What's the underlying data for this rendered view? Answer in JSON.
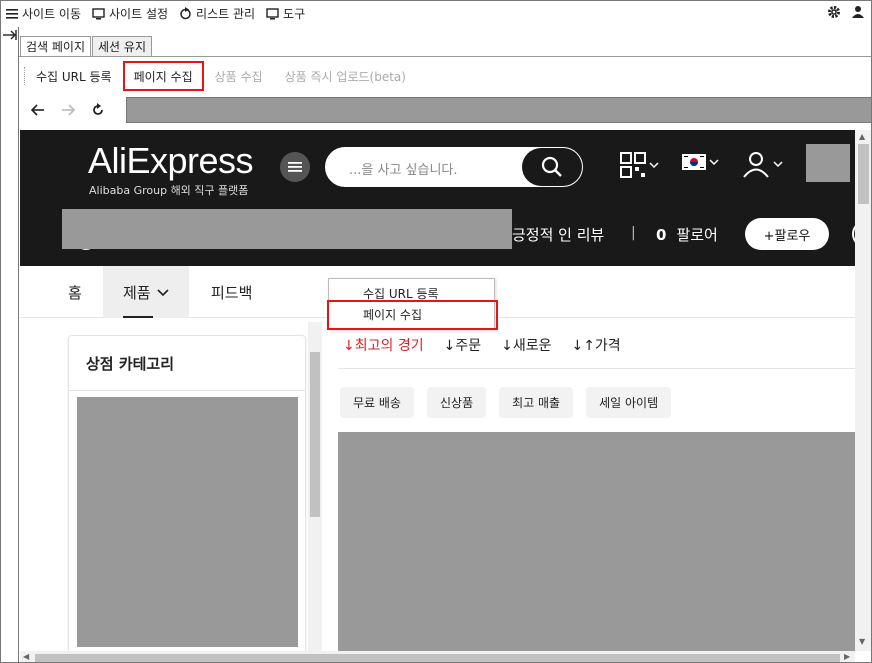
{
  "topbar": {
    "items": [
      {
        "icon": "menu-icon",
        "label": "사이트 이동"
      },
      {
        "icon": "monitor-icon",
        "label": "사이트 설정"
      },
      {
        "icon": "refresh-icon",
        "label": "리스트 관리"
      },
      {
        "icon": "monitor-icon",
        "label": "도구"
      }
    ],
    "right_icons": [
      "gear-icon",
      "person-icon"
    ]
  },
  "tabs": [
    "검색 페이지",
    "세션 유지"
  ],
  "toolbar": {
    "items": [
      {
        "label": "수집 URL 등록",
        "state": "enabled"
      },
      {
        "label": "페이지 수집",
        "state": "highlighted"
      },
      {
        "label": "상품 수집",
        "state": "disabled"
      },
      {
        "label": "상품 즉시 업로드(beta)",
        "state": "disabled"
      }
    ]
  },
  "store": {
    "logo": "AliExpress",
    "sublogo": "Alibaba Group 해외 직구 플랫폼",
    "search_placeholder": "...을 사고 싶습니다.",
    "reviews": "긍정적 인 리뷰",
    "followers_count": "0",
    "followers_label": "팔로어",
    "follow_button": "+팔로우",
    "subnav": [
      "홈",
      "제품",
      "피드백"
    ],
    "dropdown": [
      "수집 URL 등록",
      "페이지 수집"
    ],
    "category_title": "상점 카테고리",
    "sorts": [
      "↓최고의 경기",
      "↓주문",
      "↓새로운",
      "↓↑가격"
    ],
    "chips": [
      "무료 배송",
      "신상품",
      "최고 매출",
      "세일 아이템"
    ]
  },
  "colors": {
    "accent": "#e02020",
    "highlight": "#e11111",
    "header_bg": "#191919"
  }
}
